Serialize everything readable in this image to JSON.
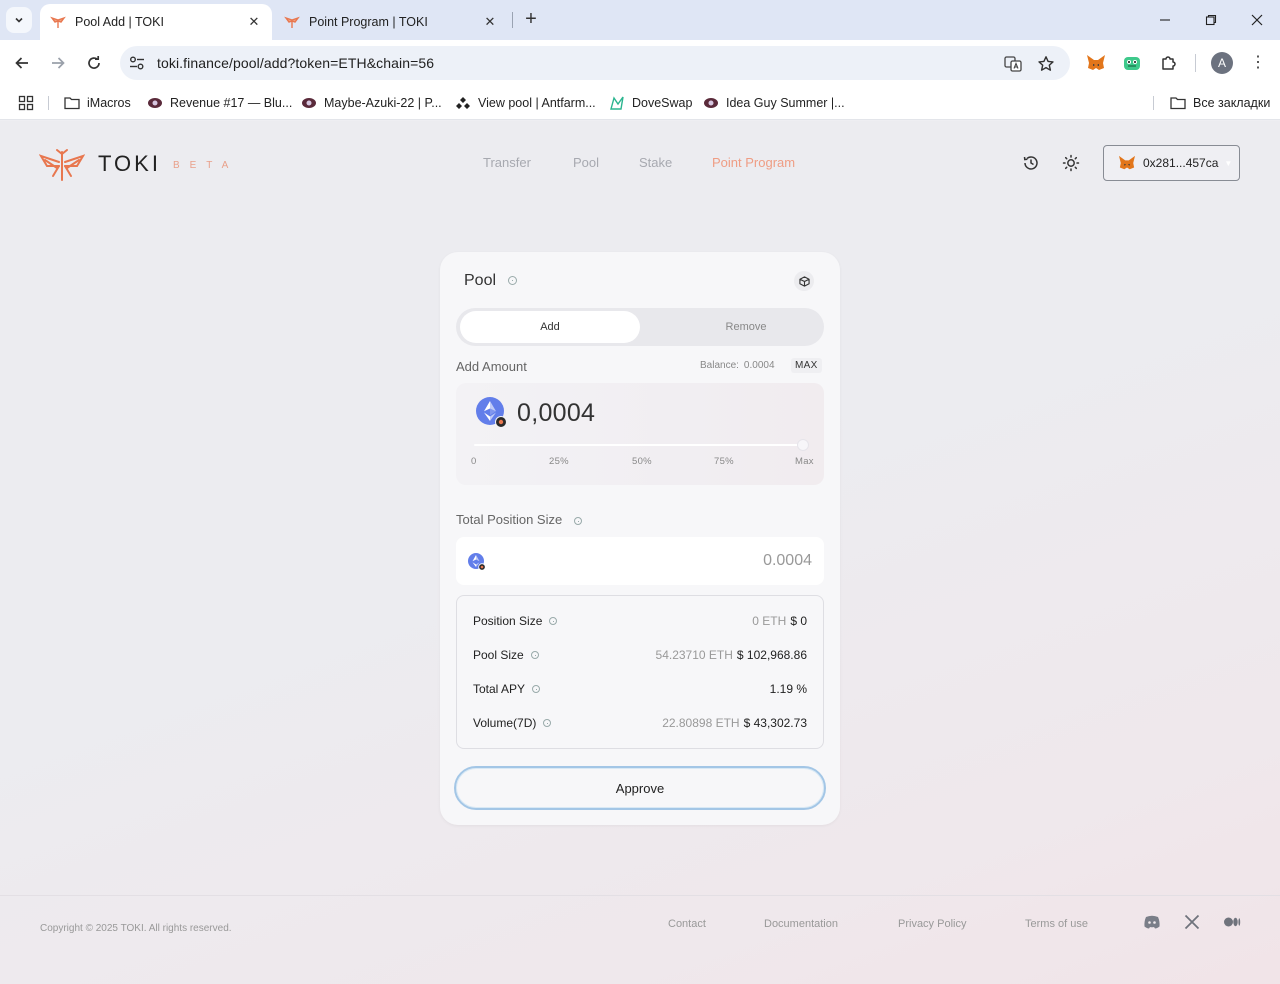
{
  "browser": {
    "tabs": [
      {
        "title": "Pool Add | TOKI",
        "active": true
      },
      {
        "title": "Point Program | TOKI",
        "active": false
      }
    ],
    "url": "toki.finance/pool/add?token=ETH&chain=56",
    "bookmarks": [
      {
        "label": "iMacros",
        "icon": "folder-icon"
      },
      {
        "label": "Revenue #17 — Blu...",
        "icon": "site-icon"
      },
      {
        "label": "Maybe-Azuki-22 | P...",
        "icon": "site-icon"
      },
      {
        "label": "View pool | Antfarm...",
        "icon": "site-icon"
      },
      {
        "label": "DoveSwap",
        "icon": "site-icon"
      },
      {
        "label": "Idea Guy Summer |...",
        "icon": "site-icon"
      }
    ],
    "all_bookmarks_label": "Все закладки",
    "profile_initial": "A"
  },
  "header": {
    "logo_text": "TOKI",
    "beta_text": "BETA",
    "nav": [
      {
        "label": "Transfer",
        "active": false
      },
      {
        "label": "Pool",
        "active": false
      },
      {
        "label": "Stake",
        "active": false
      },
      {
        "label": "Point Program",
        "active": true
      }
    ],
    "wallet_address": "0x281...457ca"
  },
  "pool_card": {
    "title": "Pool",
    "tabs": {
      "add": "Add",
      "remove": "Remove"
    },
    "add_amount_label": "Add Amount",
    "balance_label": "Balance:",
    "balance_value": "0.0004",
    "max_label": "MAX",
    "amount_value": "0,0004",
    "slider_percent": 100,
    "slider_ticks": [
      "0",
      "25%",
      "50%",
      "75%",
      "Max"
    ],
    "total_position_label": "Total Position Size",
    "total_position_value": "0.0004",
    "stats": [
      {
        "label": "Position Size",
        "muted": "0 ETH",
        "value": "$ 0"
      },
      {
        "label": "Pool Size",
        "muted": "54.23710 ETH",
        "value": "$ 102,968.86"
      },
      {
        "label": "Total APY",
        "muted": "",
        "value": "1.19 %"
      },
      {
        "label": "Volume(7D)",
        "muted": "22.80898 ETH",
        "value": "$ 43,302.73"
      }
    ],
    "approve_label": "Approve"
  },
  "footer": {
    "copyright": "Copyright © 2025 TOKI. All rights reserved.",
    "links": [
      "Contact",
      "Documentation",
      "Privacy Policy",
      "Terms of use"
    ]
  },
  "colors": {
    "accent": "#ef9d84",
    "approve_border": "#a3c6e6",
    "eth_blue": "#627eea"
  }
}
